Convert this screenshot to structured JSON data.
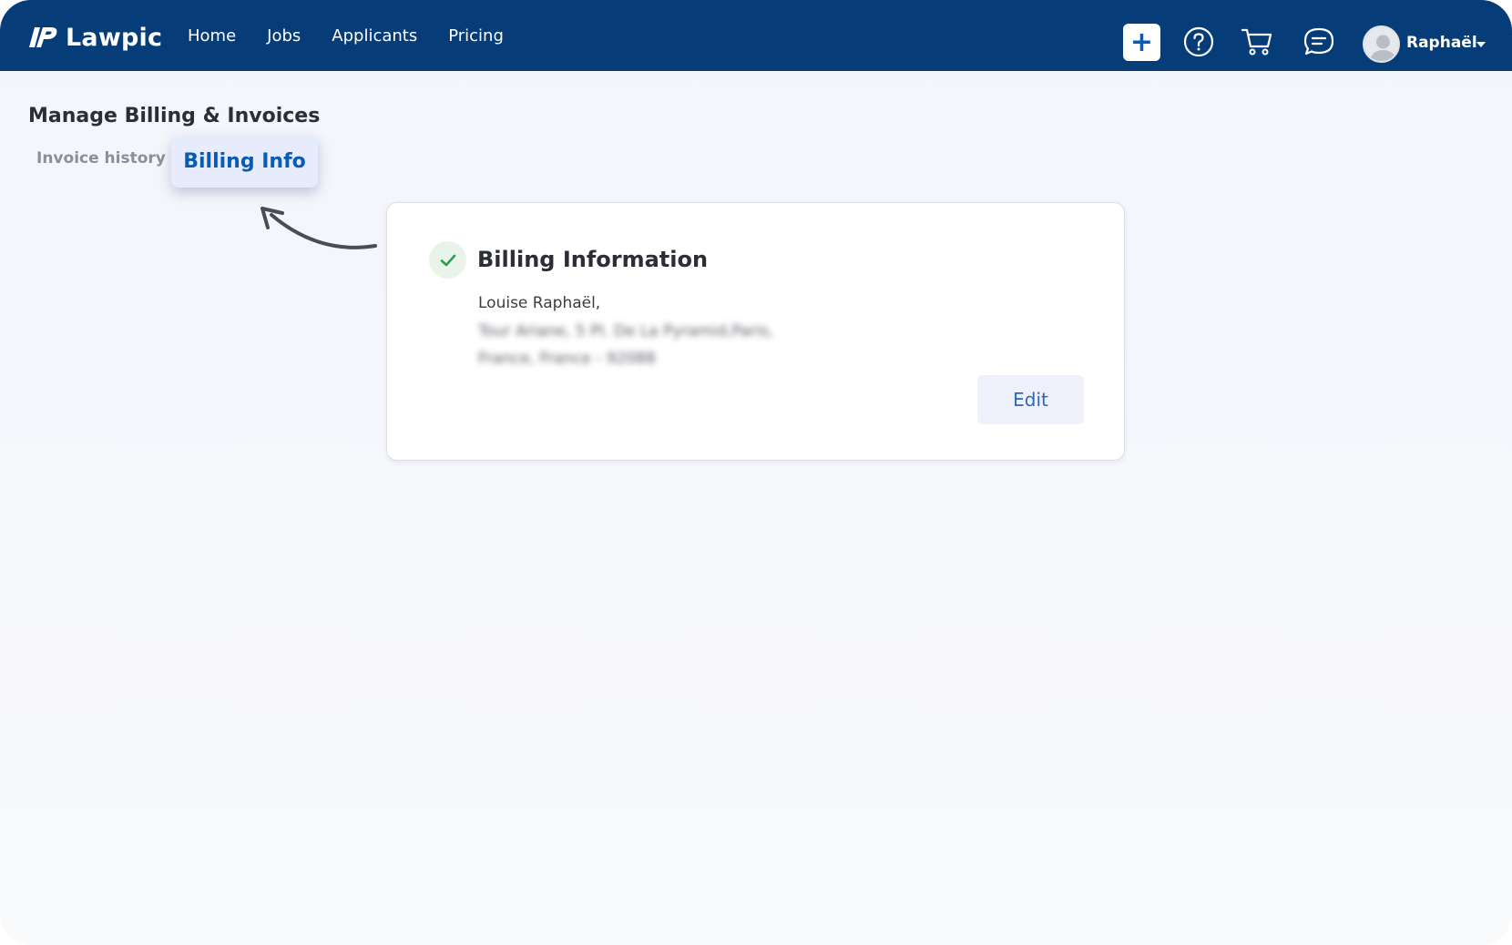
{
  "brand": {
    "name": "Lawpic",
    "logo_icon": "lawpic-logo-icon"
  },
  "nav": {
    "links": [
      "Home",
      "Jobs",
      "Applicants",
      "Pricing"
    ]
  },
  "toolbar": {
    "add_label": "+",
    "icons": [
      "help-icon",
      "cart-icon",
      "messages-icon"
    ]
  },
  "user": {
    "name": "Raphaël"
  },
  "page": {
    "title": "Manage Billing & Invoices",
    "tabs": [
      "Invoice history",
      "Billing Info"
    ],
    "active_tab": "Billing Info"
  },
  "billing_card": {
    "title": "Billing Information",
    "name_line": "Louise Raphaël,",
    "address_line_1": "Tour Ariane, 5 Pl. De La Pyramid,Paris,",
    "address_line_2": "France, France - 92088",
    "edit_label": "Edit",
    "status_icon": "check-icon"
  },
  "colors": {
    "header_bg": "#063d78",
    "accent": "#0a5bb5",
    "success": "#2e9e4f",
    "page_bg": "#f3f5fb"
  }
}
